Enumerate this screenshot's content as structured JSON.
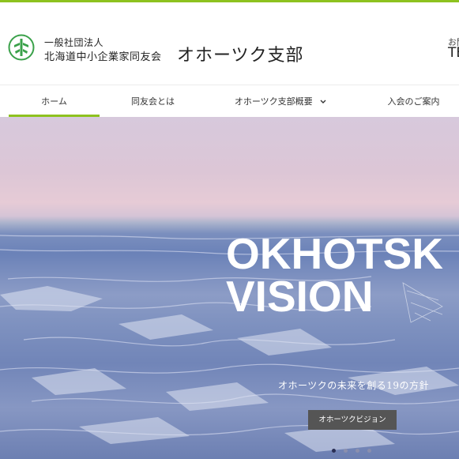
{
  "header": {
    "org_small": "一般社団法人",
    "org_main": "北海道中小企業家同友会",
    "branch": "オホーツク支部",
    "contact_label": "お問",
    "contact_tel": "TE"
  },
  "nav": {
    "items": [
      {
        "label": "ホーム",
        "active": true
      },
      {
        "label": "同友会とは"
      },
      {
        "label": "オホーツク支部概要",
        "has_dropdown": true
      },
      {
        "label": "入会のご案内"
      }
    ]
  },
  "hero": {
    "title_line1": "OKHOTSK",
    "title_line2": "VISION",
    "subtitle": "オホーツクの未来を創る19の方針",
    "button_label": "オホーツクビジョン",
    "slides_total": 4,
    "active_slide": 1
  },
  "colors": {
    "accent": "#8dc21f",
    "button": "#555555",
    "logo": "#3aa14a"
  },
  "icons": {
    "logo": "dsen-tree-logo",
    "dropdown": "chevron-down-icon"
  }
}
